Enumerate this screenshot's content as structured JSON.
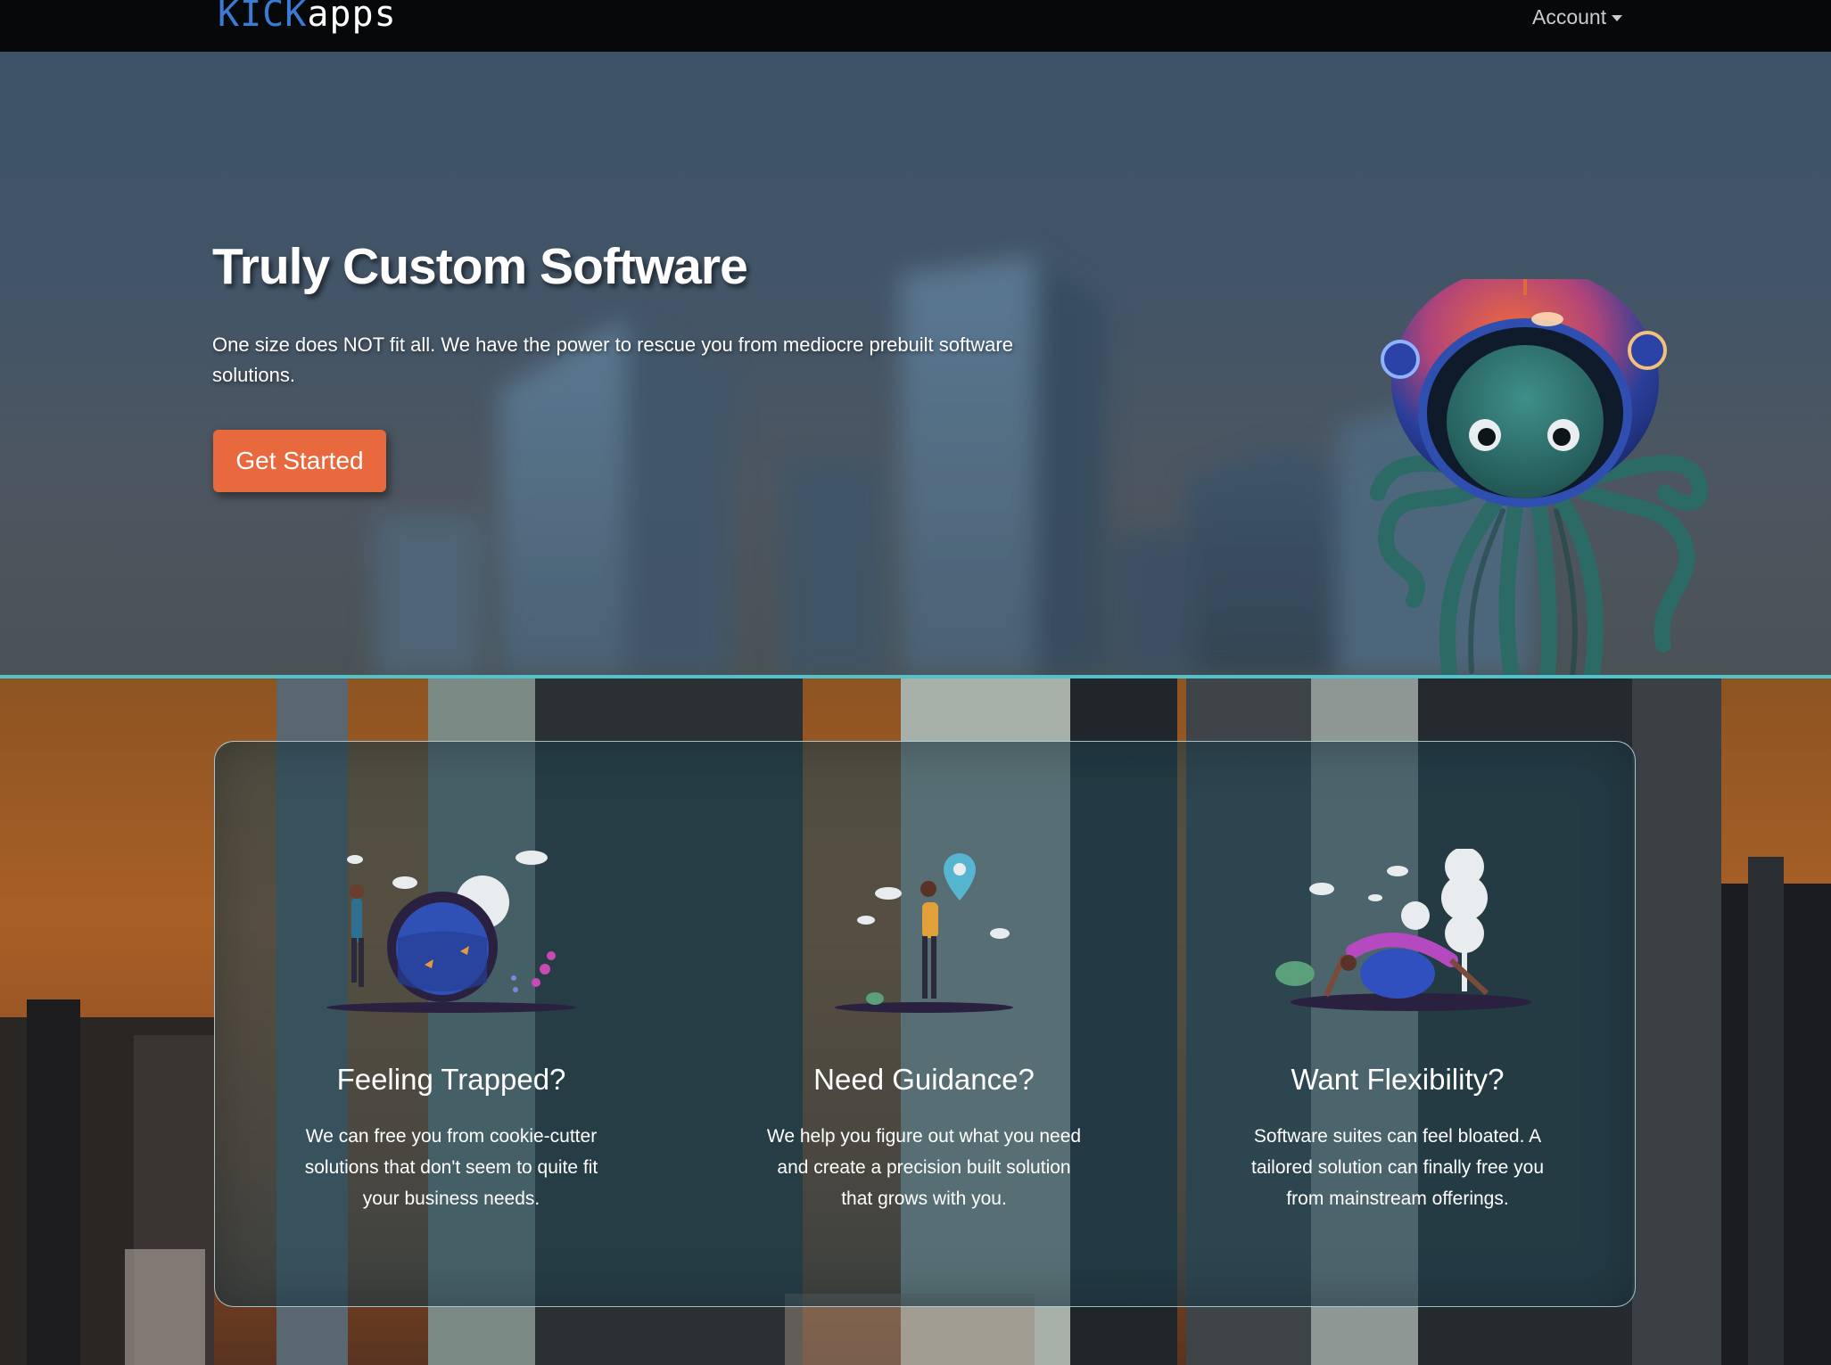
{
  "navbar": {
    "logo_kick": "KICK",
    "logo_apps": "apps",
    "account_label": "Account"
  },
  "hero": {
    "title": "Truly Custom Software",
    "subtitle": "One size does NOT fit all. We have the power to rescue you from mediocre prebuilt software solutions.",
    "cta_label": "Get Started"
  },
  "features": [
    {
      "title": "Feeling Trapped?",
      "text": "We can free you from cookie-cutter solutions that don't seem to quite fit your business needs.",
      "icon": "person-fishbowl-illustration"
    },
    {
      "title": "Need Guidance?",
      "text": "We help you figure out what you need and create a precision built solution that grows with you.",
      "icon": "person-location-pin-illustration"
    },
    {
      "title": "Want Flexibility?",
      "text": "Software suites can feel bloated. A tailored solution can finally free you from mainstream offerings.",
      "icon": "person-yoga-ball-illustration"
    }
  ],
  "colors": {
    "accent": "#e8693e",
    "divider": "#4fc3c9",
    "logo_blue": "#3a7bd5",
    "navbar_bg": "#070809"
  }
}
